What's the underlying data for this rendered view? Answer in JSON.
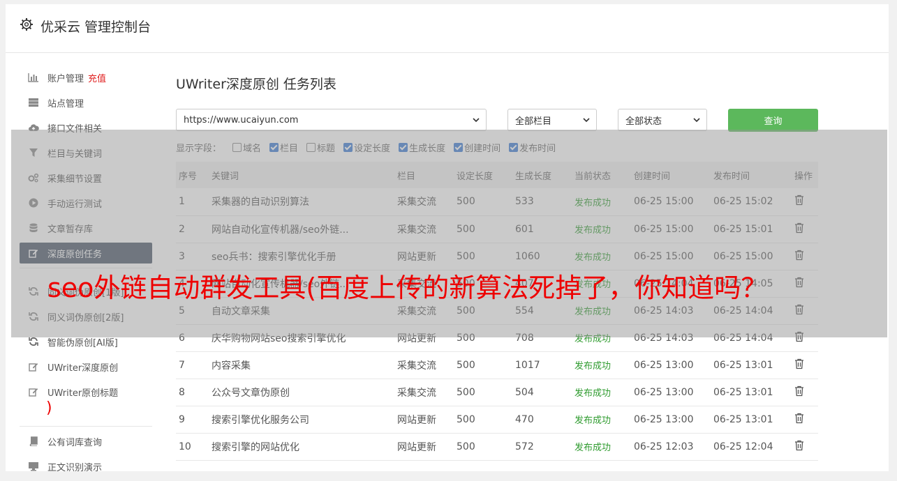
{
  "header": {
    "icon": "gear-icon",
    "title": "优采云 管理控制台"
  },
  "sidebar": {
    "items": [
      {
        "label": "账户管理",
        "badge": "充值",
        "icon": "bar-chart-icon"
      },
      {
        "label": "站点管理",
        "icon": "server-icon"
      },
      {
        "label": "接口文件相关",
        "icon": "cloud-upload-icon"
      },
      {
        "label": "栏目与关键词",
        "icon": "filter-icon"
      },
      {
        "label": "采集细节设置",
        "icon": "gears-icon"
      },
      {
        "label": "手动运行测试",
        "icon": "play-circle-icon"
      },
      {
        "label": "文章暂存库",
        "icon": "database-icon"
      },
      {
        "label": "深度原创任务",
        "icon": "edit-icon"
      },
      {
        "label": "同义词伪原创[1版]",
        "icon": "refresh-icon"
      },
      {
        "label": "同义词伪原创[2版]",
        "icon": "refresh-icon"
      },
      {
        "label": "智能伪原创[AI版]",
        "icon": "refresh-icon"
      },
      {
        "label": "UWriter深度原创",
        "icon": "edit-icon"
      },
      {
        "label": "UWriter原创标题",
        "icon": "edit-icon"
      },
      {
        "label": "公有词库查询",
        "icon": "book-icon"
      },
      {
        "label": "正文识别演示",
        "icon": "monitor-icon"
      }
    ],
    "stray_text": ")"
  },
  "main": {
    "title": "UWriter深度原创 任务列表",
    "site_select": "https://www.ucaiyun.com",
    "column_select": "全部栏目",
    "status_select": "全部状态",
    "query_label": "查询",
    "fields_label": "显示字段：",
    "fields": [
      {
        "label": "域名",
        "checked": false
      },
      {
        "label": "栏目",
        "checked": true
      },
      {
        "label": "标题",
        "checked": false
      },
      {
        "label": "设定长度",
        "checked": true
      },
      {
        "label": "生成长度",
        "checked": true
      },
      {
        "label": "创建时间",
        "checked": true
      },
      {
        "label": "发布时间",
        "checked": true
      }
    ],
    "columns": [
      "序号",
      "关键词",
      "栏目",
      "设定长度",
      "生成长度",
      "当前状态",
      "创建时间",
      "发布时间",
      "操作"
    ],
    "rows": [
      [
        "1",
        "采集器的自动识别算法",
        "采集交流",
        "500",
        "533",
        "发布成功",
        "06-25 15:00",
        "06-25 15:02"
      ],
      [
        "2",
        "网站自动化宣传机器/seo外链...",
        "采集交流",
        "500",
        "601",
        "发布成功",
        "06-25 15:00",
        "06-25 15:01"
      ],
      [
        "3",
        "seo兵书：搜索引擎优化手册",
        "网站更新",
        "500",
        "1060",
        "发布成功",
        "06-25 15:00",
        "06-25 15:00"
      ],
      [
        "4",
        "网站自动化宣传机器/seo外链...",
        "采集交流",
        "500",
        "407",
        "发布成功",
        "06-25 14:04",
        "06-25 14:05"
      ],
      [
        "5",
        "自动文章采集",
        "采集交流",
        "500",
        "554",
        "发布成功",
        "06-25 14:03",
        "06-25 14:04"
      ],
      [
        "6",
        "庆华购物网站seo搜索引擎优化",
        "网站更新",
        "500",
        "708",
        "发布成功",
        "06-25 14:03",
        "06-25 14:04"
      ],
      [
        "7",
        "内容采集",
        "采集交流",
        "500",
        "1017",
        "发布成功",
        "06-25 13:00",
        "06-25 13:01"
      ],
      [
        "8",
        "公众号文章伪原创",
        "采集交流",
        "500",
        "504",
        "发布成功",
        "06-25 13:00",
        "06-25 13:01"
      ],
      [
        "9",
        "搜索引擎优化服务公司",
        "网站更新",
        "500",
        "470",
        "发布成功",
        "06-25 13:00",
        "06-25 13:01"
      ],
      [
        "10",
        "搜索引擎的网站优化",
        "网站更新",
        "500",
        "572",
        "发布成功",
        "06-25 12:03",
        "06-25 12:04"
      ]
    ]
  },
  "overlay": {
    "text": "seo外链自动群发工具(百度上传的新算法死掉了，你知道吗？"
  },
  "colors": {
    "accent": "#5cb85c",
    "active_nav": "#4a5668",
    "overlay_text": "#e00000",
    "status_ok": "#2e9b2e"
  }
}
